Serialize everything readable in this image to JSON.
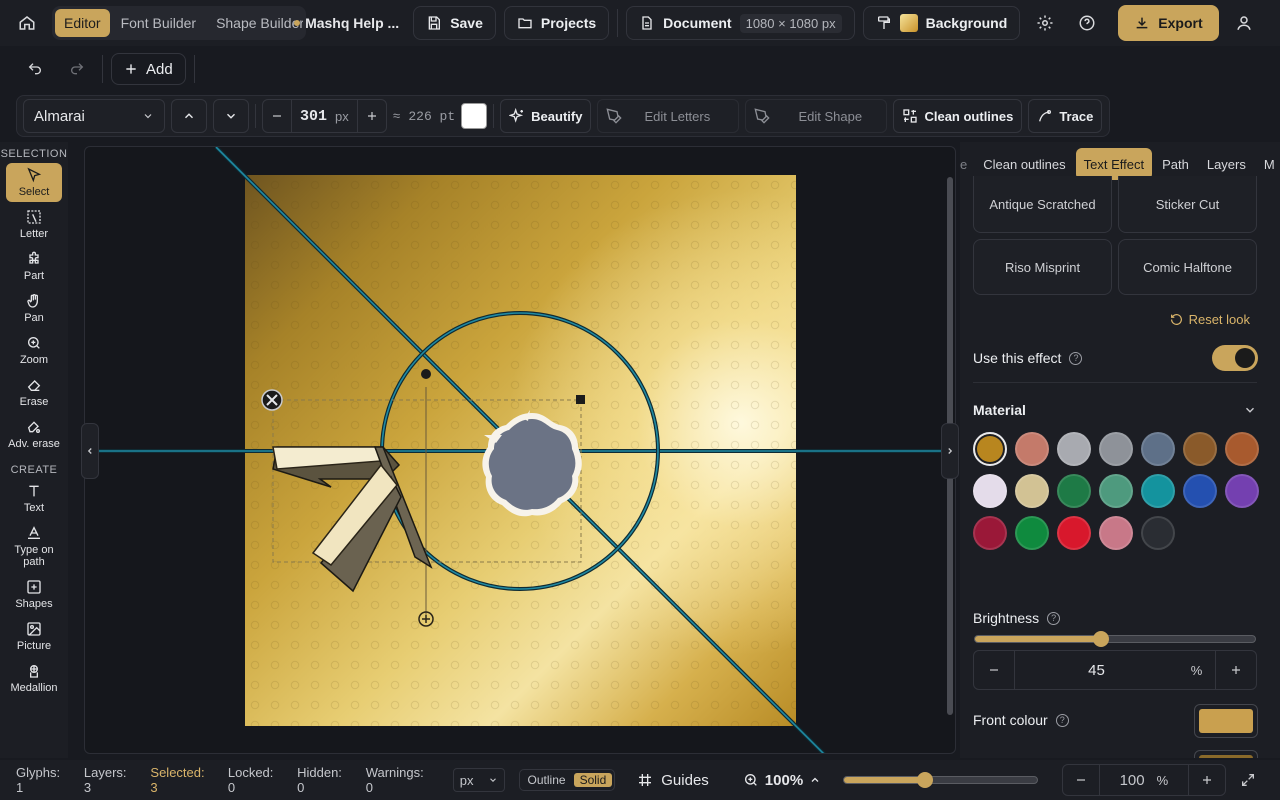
{
  "topbar": {
    "tabs": [
      {
        "label": "Editor",
        "active": true
      },
      {
        "label": "Font Builder",
        "active": false
      },
      {
        "label": "Shape Builder",
        "active": false
      }
    ],
    "project_name": "Mashq Help ...",
    "save_label": "Save",
    "projects_label": "Projects",
    "document_label": "Document",
    "document_size": "1080 × 1080 px",
    "background_label": "Background",
    "export_label": "Export",
    "accent_color": "#c9a55c"
  },
  "row2": {
    "add_label": "Add"
  },
  "toolbar": {
    "font": "Almarai",
    "size_value": "301",
    "size_unit": "px",
    "pt_approx": "≈ 226 pt",
    "beautify_label": "Beautify",
    "edit_letters_label": "Edit Letters",
    "edit_shape_label": "Edit Shape",
    "clean_outlines_label": "Clean outlines",
    "trace_label": "Trace"
  },
  "lefttools": {
    "selection_title": "SELECTION",
    "create_title": "CREATE",
    "selection": [
      {
        "label": "Select",
        "icon": "cursor-icon",
        "active": true
      },
      {
        "label": "Letter",
        "icon": "letter-select-icon",
        "active": false
      },
      {
        "label": "Part",
        "icon": "puzzle-icon",
        "active": false
      },
      {
        "label": "Pan",
        "icon": "hand-icon",
        "active": false
      },
      {
        "label": "Zoom",
        "icon": "zoom-in-icon",
        "active": false
      },
      {
        "label": "Erase",
        "icon": "eraser-icon",
        "active": false
      },
      {
        "label": "Adv. erase",
        "icon": "adv-eraser-icon",
        "active": false
      }
    ],
    "create": [
      {
        "label": "Text",
        "icon": "text-icon"
      },
      {
        "label": "Type on path",
        "icon": "type-on-path-icon"
      },
      {
        "label": "Shapes",
        "icon": "shapes-icon"
      },
      {
        "label": "Picture",
        "icon": "picture-icon"
      },
      {
        "label": "Medallion",
        "icon": "medallion-icon"
      }
    ]
  },
  "rightpanel": {
    "tabs": [
      {
        "label": "e",
        "active": false
      },
      {
        "label": "Clean outlines",
        "active": false
      },
      {
        "label": "Text Effect",
        "active": true
      },
      {
        "label": "Path",
        "active": false
      },
      {
        "label": "Layers",
        "active": false
      },
      {
        "label": "M",
        "active": false
      }
    ],
    "effects": [
      "Antique Scratched",
      "Sticker Cut",
      "Riso Misprint",
      "Comic Halftone"
    ],
    "reset_label": "Reset look",
    "use_effect_label": "Use this effect",
    "use_effect_on": true,
    "material_label": "Material",
    "material_colors": [
      "#b8861f",
      "#c47a6a",
      "#a8aab0",
      "#8e9299",
      "#5e7088",
      "#8a5a2a",
      "#a85a2e",
      "#e4dcea",
      "#d2c294",
      "#1e7a46",
      "#4e9a7e",
      "#14939e",
      "#2450b0",
      "#7440b0",
      "#9a1838",
      "#0f8a3e",
      "#d8182c",
      "#c87888",
      "#2a2d33"
    ],
    "selected_material": 0,
    "brightness_label": "Brightness",
    "brightness_value": "45",
    "brightness_unit": "%",
    "brightness_fraction": 0.45,
    "front_colour_label": "Front colour",
    "front_colour": "#c9a04f"
  },
  "status": {
    "glyphs": "Glyphs: 1",
    "layers": "Layers: 3",
    "selected": "Selected: 3",
    "locked": "Locked: 0",
    "hidden": "Hidden: 0",
    "warnings": "Warnings: 0",
    "unit": "px",
    "outline_label": "Outline",
    "solid_label": "Solid",
    "guides_label": "Guides",
    "zoom_label": "100%",
    "zoom_value": "100",
    "zoom_unit": "%",
    "zoom_fraction": 0.42
  }
}
